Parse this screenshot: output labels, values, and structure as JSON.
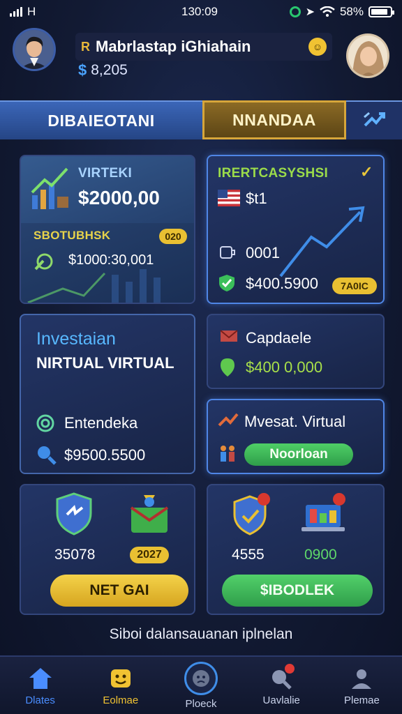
{
  "status": {
    "carrier": "H",
    "time": "130:09",
    "battery": "58%"
  },
  "header": {
    "name": "Mabrlastap iGhiahain",
    "name_mark": "R",
    "balance_symbol": "$",
    "balance": "8,205"
  },
  "tabs": {
    "left": "DIBAIEOTANI",
    "middle": "NNANDAA",
    "right_icon": "refresh-arrows-icon"
  },
  "card_virteki": {
    "title": "VIRTEKI",
    "amount": "$2000,00",
    "subtitle": "SBOTUBHSK",
    "badge": "020",
    "value": "$1000:30,001"
  },
  "card_ireri": {
    "title": "IRERTCASYSHSI",
    "row1_value": "$t1",
    "row2_value": "0001",
    "row3_value": "$400.5900",
    "badge": "7A0IC"
  },
  "card_investasi": {
    "title": "Investaian",
    "subtitle": "NIRTUAL VIRTUAL",
    "row1_label": "Entendeka",
    "row2_value": "$9500.5500"
  },
  "card_capdale": {
    "title": "Capdaele",
    "value": "$400 0,000"
  },
  "card_mvesat": {
    "title": "Mvesat. Virtual",
    "button": "Noorloan"
  },
  "card_left_bottom": {
    "left_value": "35078",
    "right_value": "2027",
    "button": "NET GAI"
  },
  "card_right_bottom": {
    "left_value": "4555",
    "right_value": "0900",
    "button": "$IBODLEK"
  },
  "footer_text": "Siboi dalansauanan iplnelan",
  "nav": [
    {
      "label": "Dlates",
      "color": "#4a8dff"
    },
    {
      "label": "Eolmae",
      "color": "#f0c232"
    },
    {
      "label": "Ploeck",
      "color": "#c9d2ea"
    },
    {
      "label": "Uavlalie",
      "color": "#c9d2ea"
    },
    {
      "label": "Plemae",
      "color": "#c9d2ea"
    }
  ]
}
